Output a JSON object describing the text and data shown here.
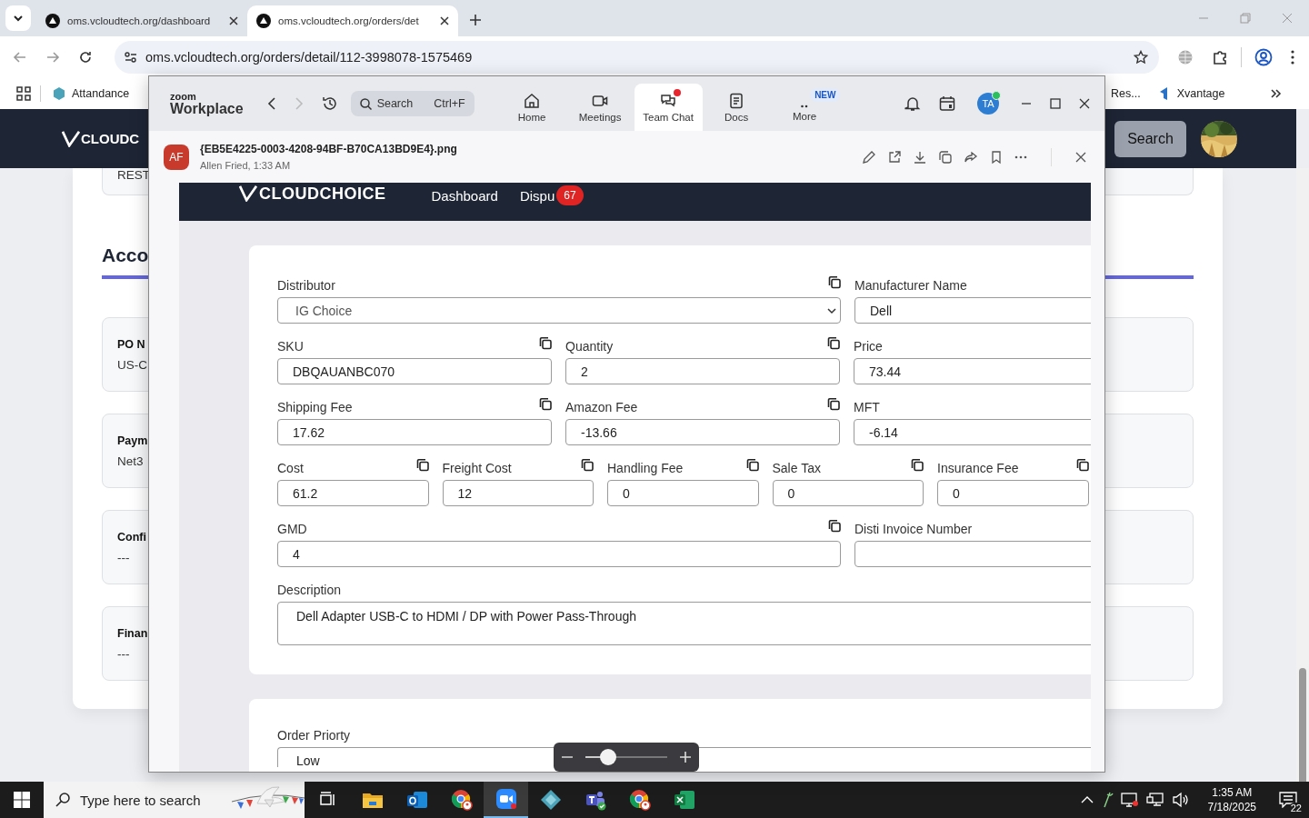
{
  "browser": {
    "tabs": [
      {
        "title": "oms.vcloudtech.org/dashboard",
        "selected": false
      },
      {
        "title": "oms.vcloudtech.org/orders/det",
        "selected": true
      }
    ],
    "url": "oms.vcloudtech.org/orders/detail/112-3998078-1575469",
    "bookmarks_left": [
      {
        "label": "Attandance"
      }
    ],
    "bookmarks_right": [
      {
        "label": "Res...",
        "icon": false
      },
      {
        "label": "Xvantage",
        "icon": true
      }
    ]
  },
  "page": {
    "logo": "CLOUDC",
    "search_button": "Search",
    "top_card_text": "REST",
    "section_title": "Acco",
    "cards": [
      {
        "title": "PO N",
        "value": "US-C"
      },
      {
        "title": "Paym",
        "value": "Net3"
      },
      {
        "title": "Confi",
        "value": "---"
      },
      {
        "title": "Finan",
        "value": "---"
      }
    ]
  },
  "zoom": {
    "brand_small": "zoom",
    "brand": "Workplace",
    "search": {
      "placeholder": "Search",
      "shortcut": "Ctrl+F"
    },
    "tabs": [
      {
        "label": "Home",
        "kind": "home",
        "selected": false,
        "unread": false
      },
      {
        "label": "Meetings",
        "kind": "camera",
        "selected": false,
        "unread": false
      },
      {
        "label": "Team Chat",
        "kind": "chat",
        "selected": true,
        "unread": true
      },
      {
        "label": "Docs",
        "kind": "doc",
        "selected": false,
        "unread": false
      },
      {
        "label": "More",
        "kind": "more",
        "selected": false,
        "unread": false,
        "badge": "NEW"
      }
    ],
    "avatar": {
      "initials": "TA",
      "online": true
    },
    "message": {
      "avatar": "AF",
      "filename": "{EB5E4225-0003-4208-94BF-B70CA13BD9E4}.png",
      "meta": "Allen Fried, 1:33 AM"
    },
    "image": {
      "logo": "CLOUDCHOICE",
      "nav": [
        "Dashboard",
        "Dispu"
      ],
      "nav_badge": "67",
      "rows": [
        {
          "kind": "wide-narrow",
          "fields": [
            {
              "label": "Distributor",
              "value": "IG Choice",
              "kind": "select",
              "copy": true
            },
            {
              "label": "Manufacturer Name",
              "value": "Dell",
              "kind": "input",
              "copy": false
            }
          ]
        },
        {
          "kind": "thirds",
          "fields": [
            {
              "label": "SKU",
              "value": "DBQAUANBC070",
              "kind": "input",
              "copy": true
            },
            {
              "label": "Quantity",
              "value": "2",
              "kind": "input",
              "copy": true
            },
            {
              "label": "Price",
              "value": "73.44",
              "kind": "input",
              "copy": false
            }
          ]
        },
        {
          "kind": "thirds",
          "fields": [
            {
              "label": "Shipping Fee",
              "value": "17.62",
              "kind": "input",
              "copy": true
            },
            {
              "label": "Amazon Fee",
              "value": "-13.66",
              "kind": "input",
              "copy": true
            },
            {
              "label": "MFT",
              "value": "-6.14",
              "kind": "input",
              "copy": false
            }
          ]
        },
        {
          "kind": "fifths",
          "fields": [
            {
              "label": "Cost",
              "value": "61.2",
              "kind": "input",
              "copy": true
            },
            {
              "label": "Freight Cost",
              "value": "12",
              "kind": "input",
              "copy": true
            },
            {
              "label": "Handling Fee",
              "value": "0",
              "kind": "input",
              "copy": true
            },
            {
              "label": "Sale Tax",
              "value": "0",
              "kind": "input",
              "copy": true
            },
            {
              "label": "Insurance Fee",
              "value": "0",
              "kind": "input",
              "copy": true
            }
          ]
        },
        {
          "kind": "wide-narrow",
          "fields": [
            {
              "label": "GMD",
              "value": "4",
              "kind": "input",
              "copy": true
            },
            {
              "label": "Disti Invoice Number",
              "kind": "input",
              "copy": false
            }
          ]
        },
        {
          "kind": "full",
          "fields": [
            {
              "label": "Description",
              "value": "Dell Adapter USB-C to HDMI / DP with Power Pass-Through",
              "kind": "textarea",
              "copy": false
            }
          ]
        }
      ],
      "second_card": {
        "label": "Order Priorty",
        "value": "Low"
      }
    },
    "zoom_slider": {
      "level": 0.28
    }
  },
  "taskbar": {
    "search_placeholder": "Type here to search",
    "apps": [
      {
        "kind": "task-view",
        "selected": false
      },
      {
        "kind": "folder",
        "selected": false
      },
      {
        "kind": "mail",
        "selected": false
      },
      {
        "kind": "chrome",
        "selected": false
      },
      {
        "kind": "zoom",
        "selected": true
      },
      {
        "kind": "diamond",
        "selected": false
      },
      {
        "kind": "teams",
        "selected": false
      },
      {
        "kind": "chrome",
        "selected": false
      },
      {
        "kind": "sheet",
        "selected": false
      }
    ],
    "time": "1:35 AM",
    "date": "7/18/2025",
    "notifications": "22"
  }
}
